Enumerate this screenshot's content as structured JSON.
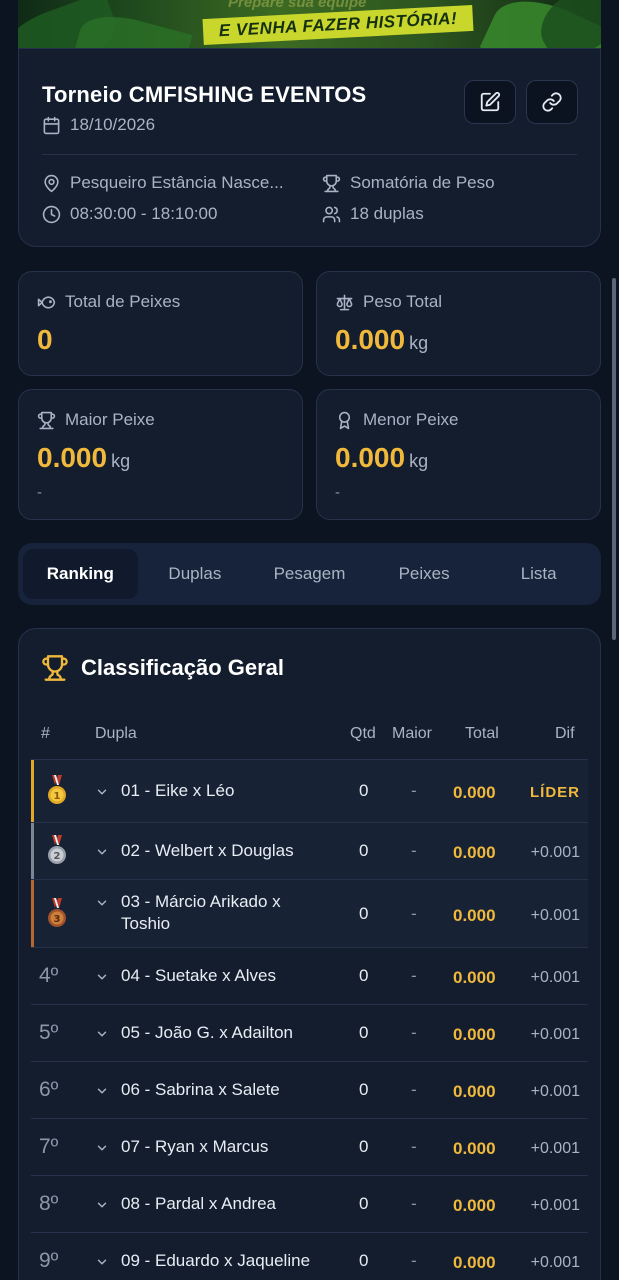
{
  "banner": {
    "text_top": "Prepare sua equipe",
    "text": "E VENHA FAZER HISTÓRIA!"
  },
  "event": {
    "title": "Torneio CMFISHING EVENTOS",
    "date": "18/10/2026",
    "location": "Pesqueiro Estância Nasce...",
    "time": "08:30:00 - 18:10:00",
    "mode": "Somatória de Peso",
    "teams": "18 duplas"
  },
  "stats": {
    "total_fish": {
      "label": "Total de Peixes",
      "value": "0"
    },
    "total_weight": {
      "label": "Peso Total",
      "value": "0.000",
      "unit": "kg"
    },
    "biggest": {
      "label": "Maior Peixe",
      "value": "0.000",
      "unit": "kg",
      "sub": "-"
    },
    "smallest": {
      "label": "Menor Peixe",
      "value": "0.000",
      "unit": "kg",
      "sub": "-"
    }
  },
  "tabs": [
    "Ranking",
    "Duplas",
    "Pesagem",
    "Peixes",
    "Lista"
  ],
  "ranking": {
    "title": "Classificação Geral",
    "columns": {
      "pos": "#",
      "team": "Dupla",
      "qtd": "Qtd",
      "maior": "Maior",
      "total": "Total",
      "dif": "Dif"
    },
    "rows": [
      {
        "pos": "1",
        "name": "01 - Eike x Léo",
        "qtd": "0",
        "maior": "-",
        "total": "0.000",
        "dif": "LÍDER"
      },
      {
        "pos": "2",
        "name": "02 - Welbert x Douglas",
        "qtd": "0",
        "maior": "-",
        "total": "0.000",
        "dif": "+0.001"
      },
      {
        "pos": "3",
        "name": "03 - Márcio Arikado x Toshio",
        "qtd": "0",
        "maior": "-",
        "total": "0.000",
        "dif": "+0.001"
      },
      {
        "pos": "4º",
        "name": "04 - Suetake x Alves",
        "qtd": "0",
        "maior": "-",
        "total": "0.000",
        "dif": "+0.001"
      },
      {
        "pos": "5º",
        "name": "05 - João G. x Adailton",
        "qtd": "0",
        "maior": "-",
        "total": "0.000",
        "dif": "+0.001"
      },
      {
        "pos": "6º",
        "name": "06 - Sabrina x Salete",
        "qtd": "0",
        "maior": "-",
        "total": "0.000",
        "dif": "+0.001"
      },
      {
        "pos": "7º",
        "name": "07 - Ryan x Marcus",
        "qtd": "0",
        "maior": "-",
        "total": "0.000",
        "dif": "+0.001"
      },
      {
        "pos": "8º",
        "name": "08 - Pardal x Andrea",
        "qtd": "0",
        "maior": "-",
        "total": "0.000",
        "dif": "+0.001"
      },
      {
        "pos": "9º",
        "name": "09 - Eduardo x Jaqueline",
        "qtd": "0",
        "maior": "-",
        "total": "0.000",
        "dif": "+0.001"
      }
    ]
  },
  "colors": {
    "accent_gold": "#f1b93c",
    "gold_medal": "#e0a825",
    "silver_medal": "#b9bec7",
    "bronze_medal": "#c0682c",
    "background": "#0c1422",
    "card": "#131d2e"
  }
}
